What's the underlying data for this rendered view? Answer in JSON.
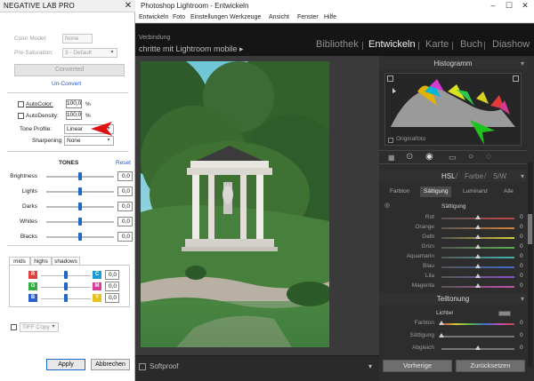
{
  "lightroom": {
    "title": "Photoshop Lightroom - Entwickeln",
    "menu": [
      "Entwickeln",
      "Foto",
      "Einstellungen",
      "Werkzeuge",
      "Ansicht",
      "Fenster",
      "Hilfe"
    ],
    "identity_line1": "Verbindung",
    "identity_line2": "chritte mit Lightroom mobile ▸",
    "modules": [
      "Bibliothek",
      "Entwickeln",
      "Karte",
      "Buch",
      "Diashow"
    ],
    "active_module": "Entwickeln",
    "softproof_label": "Softproof",
    "histogram": {
      "title": "Histogramm",
      "original_label": "Originalfoto"
    },
    "hsl": {
      "tabs": [
        "HSL",
        "Farbe",
        "S/W"
      ],
      "subtabs": [
        "Farbton",
        "Sättigung",
        "Luminanz",
        "Alle"
      ],
      "active_subtab": "Sättigung",
      "group_label": "Sättigung",
      "rows": [
        {
          "label": "Rot",
          "value": "0"
        },
        {
          "label": "Orange",
          "value": "0"
        },
        {
          "label": "Gelb",
          "value": "0"
        },
        {
          "label": "Grün",
          "value": "0"
        },
        {
          "label": "Aquamarin",
          "value": "0"
        },
        {
          "label": "Blau",
          "value": "0"
        },
        {
          "label": "Lila",
          "value": "0"
        },
        {
          "label": "Magenta",
          "value": "0"
        }
      ]
    },
    "split_toning": {
      "title": "Teiltonung",
      "lights_label": "Lichter",
      "rows": [
        {
          "label": "Farbton",
          "value": "0"
        },
        {
          "label": "Sättigung",
          "value": "0"
        },
        {
          "label": "Abgleich",
          "value": "0"
        }
      ]
    },
    "buttons": {
      "previous": "Vorherige",
      "reset": "Zurücksetzen"
    },
    "colors": {
      "arrow": "#1ec41e",
      "accent": "#f0f0f0"
    }
  },
  "nlp": {
    "title": "NEGATIVE LAB PRO",
    "color_model_label": "Color Model:",
    "color_model_value": "None",
    "pre_saturation_label": "Pre-Saturation:",
    "pre_saturation_value": "3 - Default",
    "converted_label": "Converted",
    "unconvert_label": "Un-Convert",
    "autocolor_label": "AutoColor:",
    "autocolor_value": "100,0",
    "autodensity_label": "AutoDensity:",
    "autodensity_value": "100,0",
    "percent": "%",
    "tone_profile_label": "Tone Profile:",
    "tone_profile_value": "Linear",
    "sharpening_label": "Sharpening",
    "sharpening_value": "None",
    "tones_title": "TONES",
    "reset_label": "Reset",
    "tones": [
      {
        "label": "Brightness",
        "value": "0,0"
      },
      {
        "label": "Lights",
        "value": "0,0"
      },
      {
        "label": "Darks",
        "value": "0,0"
      },
      {
        "label": "Whites",
        "value": "0,0"
      },
      {
        "label": "Blacks",
        "value": "0,0"
      }
    ],
    "tabs": [
      "mids",
      "highs",
      "shadows"
    ],
    "active_tab": "mids",
    "channels": [
      {
        "left": "R",
        "right": "C",
        "value": "0,0",
        "left_color": "#e04040",
        "right_color": "#1e9ad6"
      },
      {
        "left": "G",
        "right": "M",
        "value": "0,0",
        "left_color": "#2fae3f",
        "right_color": "#d83b96"
      },
      {
        "left": "B",
        "right": "Y",
        "value": "0,0",
        "left_color": "#2b5fd0",
        "right_color": "#e8c21e"
      }
    ],
    "tiff_label": "TIFF Copy",
    "apply_label": "Apply",
    "cancel_label": "Abbrechen",
    "colors": {
      "arrow": "#e01010",
      "link": "#1f55d6",
      "thumb": "#1e69c8"
    }
  }
}
